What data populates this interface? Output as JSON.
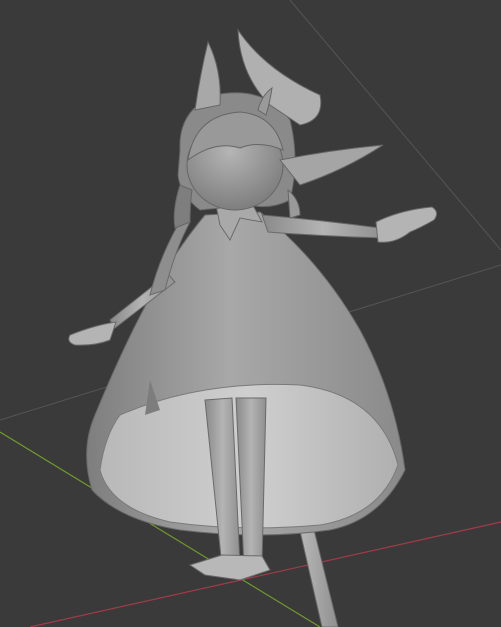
{
  "viewport": {
    "background": "#3a3a3a",
    "grid_line_color": "#555555",
    "axis_x_color": "#a23b49",
    "axis_y_color": "#6f9a2a",
    "model_fill": "#9c9c9c",
    "model_dark": "#6e6e6e",
    "model_light": "#c2c2c2"
  }
}
